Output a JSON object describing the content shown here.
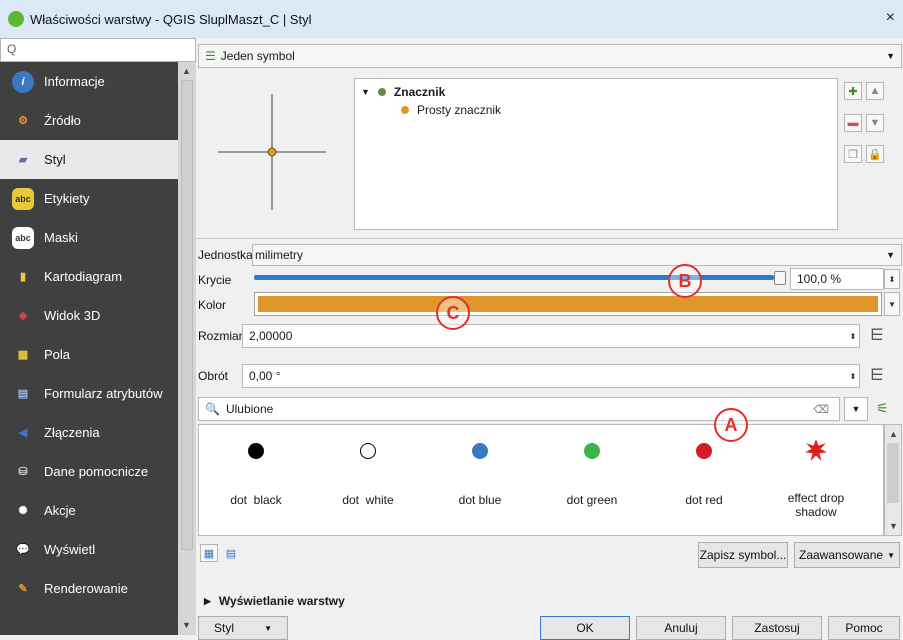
{
  "window": {
    "title": "Właściwości warstwy - QGIS SluplMaszt_C | Styl",
    "close": "×"
  },
  "sidebar": {
    "search_icon": "Q",
    "items": [
      {
        "label": "Informacje",
        "icon": "info-icon"
      },
      {
        "label": "Źródło",
        "icon": "source-icon"
      },
      {
        "label": "Styl",
        "icon": "style-brush-icon"
      },
      {
        "label": "Etykiety",
        "icon": "labels-icon"
      },
      {
        "label": "Maski",
        "icon": "masks-icon"
      },
      {
        "label": "Kartodiagram",
        "icon": "diagram-icon"
      },
      {
        "label": "Widok 3D",
        "icon": "cube-3d-icon"
      },
      {
        "label": "Pola",
        "icon": "fields-icon"
      },
      {
        "label": "Formularz atrybutów",
        "icon": "form-icon"
      },
      {
        "label": "Złączenia",
        "icon": "joins-icon"
      },
      {
        "label": "Dane pomocnicze",
        "icon": "auxiliary-data-icon"
      },
      {
        "label": "Akcje",
        "icon": "actions-icon"
      },
      {
        "label": "Wyświetl",
        "icon": "display-icon"
      },
      {
        "label": "Renderowanie",
        "icon": "rendering-icon"
      }
    ]
  },
  "renderer": {
    "value": "Jeden symbol"
  },
  "tree": {
    "root": "Znacznik",
    "child": "Prosty znacznik"
  },
  "props": {
    "unit_label": "Jednostka",
    "unit_value": "milimetry",
    "opacity_label": "Krycie",
    "opacity_value": "100,0 %",
    "opacity_fraction": 1.0,
    "color_label": "Kolor",
    "color_hex": "#e0962a",
    "size_label": "Rozmiar",
    "size_value": "2,00000",
    "rotation_label": "Obrót",
    "rotation_value": "0,00 °"
  },
  "library": {
    "search_value": "Ulubione",
    "symbols": [
      {
        "label": "dot  black",
        "color": "#000000"
      },
      {
        "label": "dot  white",
        "color": "#ffffff"
      },
      {
        "label": "dot blue",
        "color": "#3a78c2"
      },
      {
        "label": "dot green",
        "color": "#3cb44a"
      },
      {
        "label": "dot red",
        "color": "#d01d2a"
      },
      {
        "label": "effect drop shadow",
        "color": "#e31c1c"
      }
    ],
    "save_symbol": "Zapisz symbol...",
    "advanced": "Zaawansowane"
  },
  "section": {
    "layer_rendering": "Wyświetlanie warstwy"
  },
  "footer": {
    "style_menu": "Styl",
    "ok": "OK",
    "cancel": "Anuluj",
    "apply": "Zastosuj",
    "help": "Pomoc"
  },
  "annotations": {
    "a": "A",
    "b": "B",
    "c": "C"
  }
}
